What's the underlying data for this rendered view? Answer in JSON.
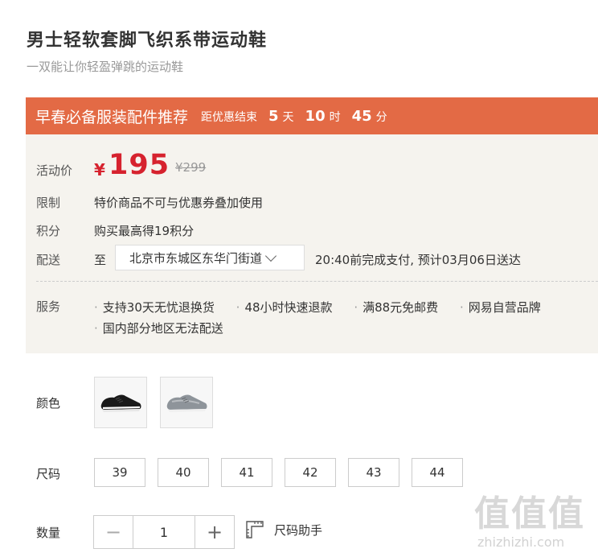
{
  "product": {
    "title": "男士轻软套脚飞织系带运动鞋",
    "subtitle": "一双能让你轻盈弹跳的运动鞋"
  },
  "promo": {
    "title": "早春必备服装配件推荐",
    "countdown_label": "距优惠结束",
    "days": "5",
    "days_unit": "天",
    "hours": "10",
    "hours_unit": "时",
    "minutes": "45",
    "minutes_unit": "分",
    "bg_color": "#e36a45"
  },
  "price": {
    "label": "活动价",
    "currency": "¥",
    "current": "195",
    "original": "¥299",
    "color": "#d6222e"
  },
  "limit": {
    "label": "限制",
    "text": "特价商品不可与优惠券叠加使用"
  },
  "points": {
    "label": "积分",
    "text": "购买最高得19积分"
  },
  "delivery": {
    "label": "配送",
    "to": "至",
    "address": "北京市东城区东华门街道",
    "note": "20:40前完成支付, 预计03月06日送达"
  },
  "services": {
    "label": "服务",
    "items": [
      "支持30天无忧退换货",
      "48小时快速退款",
      "满88元免邮费",
      "网易自营品牌",
      "国内部分地区无法配送"
    ]
  },
  "color": {
    "label": "颜色",
    "options": [
      {
        "name": "black-shoe",
        "icon": "black-sneaker"
      },
      {
        "name": "grey-shoe",
        "icon": "grey-sneaker"
      }
    ]
  },
  "size": {
    "label": "尺码",
    "options": [
      "39",
      "40",
      "41",
      "42",
      "43",
      "44"
    ]
  },
  "quantity": {
    "label": "数量",
    "minus": "−",
    "value": "1",
    "plus": "+",
    "size_helper": "尺码助手"
  },
  "watermark": {
    "logo": "值值值",
    "url": "zhizhizhi.com"
  }
}
